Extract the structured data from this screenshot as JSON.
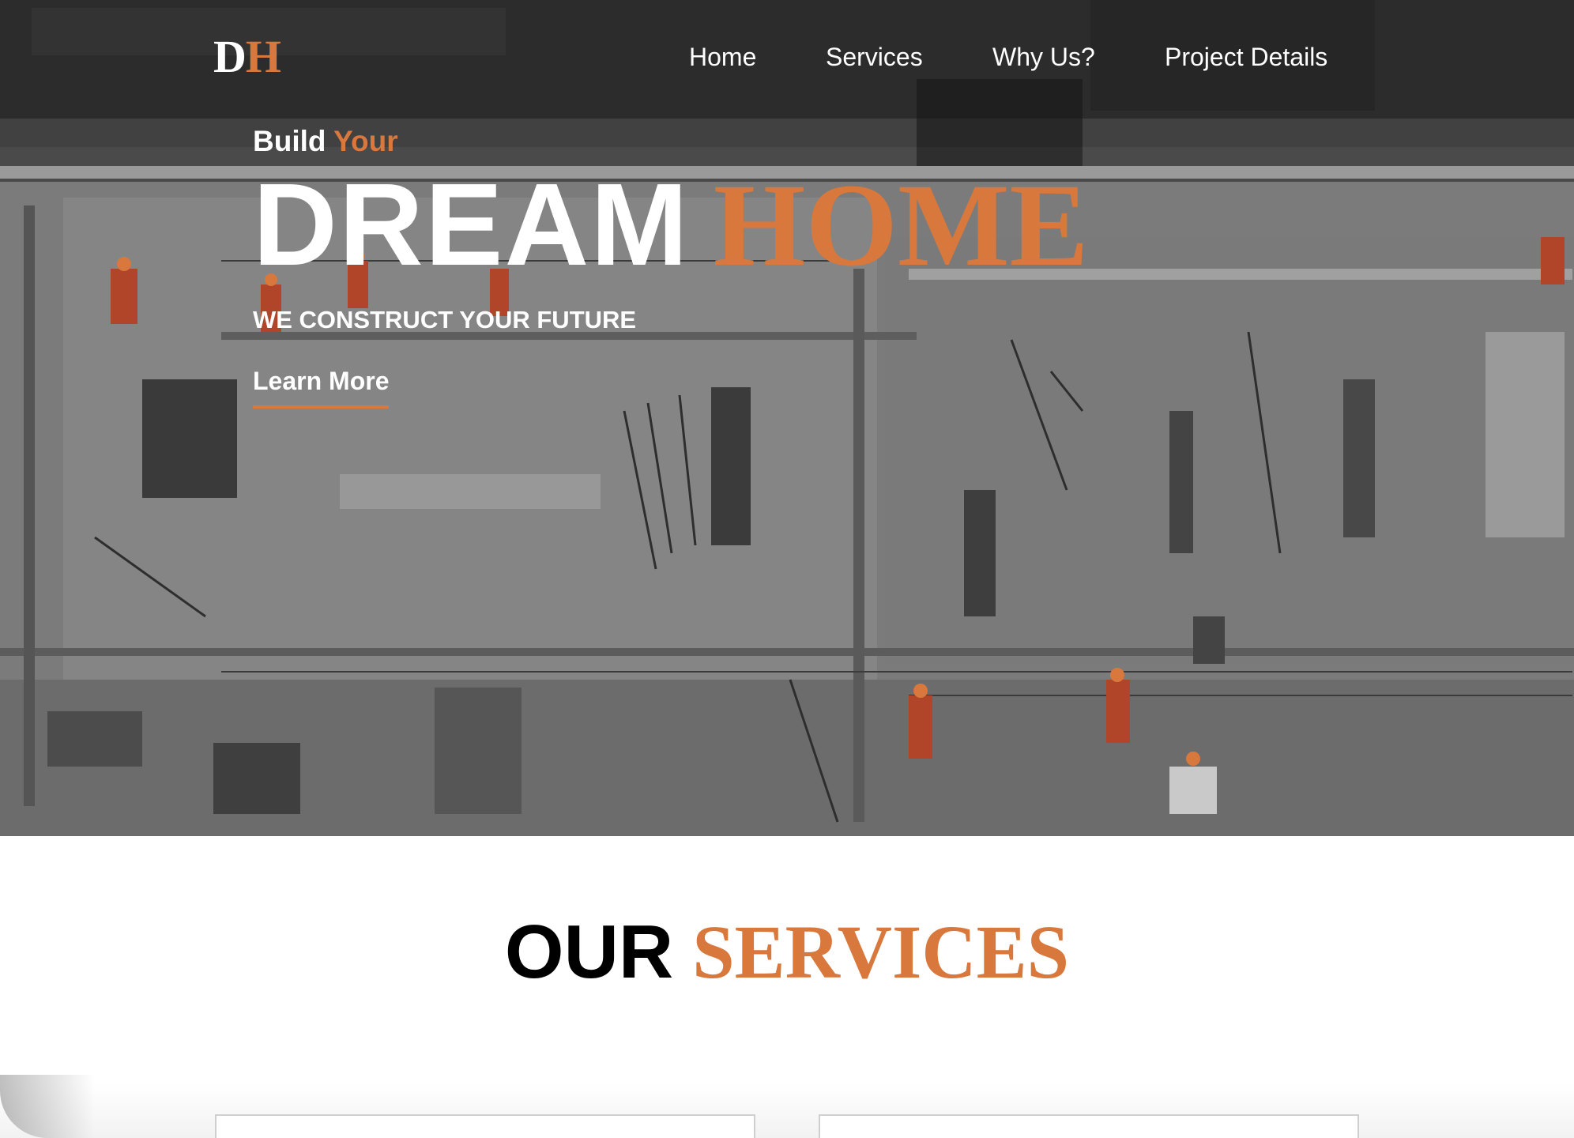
{
  "header": {
    "logo": {
      "first": "D",
      "second": "H"
    },
    "nav": [
      {
        "label": "Home"
      },
      {
        "label": "Services"
      },
      {
        "label": "Why Us?"
      },
      {
        "label": "Project Details"
      }
    ]
  },
  "hero": {
    "build_white": "Build",
    "build_orange": "Your",
    "headline_white": "DREAM",
    "headline_orange": "HOME",
    "tagline": "WE CONSTRUCT YOUR FUTURE",
    "cta_label": "Learn More",
    "background": "construction-site-photo"
  },
  "services": {
    "title_black": "OUR",
    "title_orange": "SERVICES"
  },
  "colors": {
    "accent": "#d8783d",
    "nav_overlay": "#141414",
    "text_light": "#ffffff",
    "text_dark": "#000000"
  }
}
